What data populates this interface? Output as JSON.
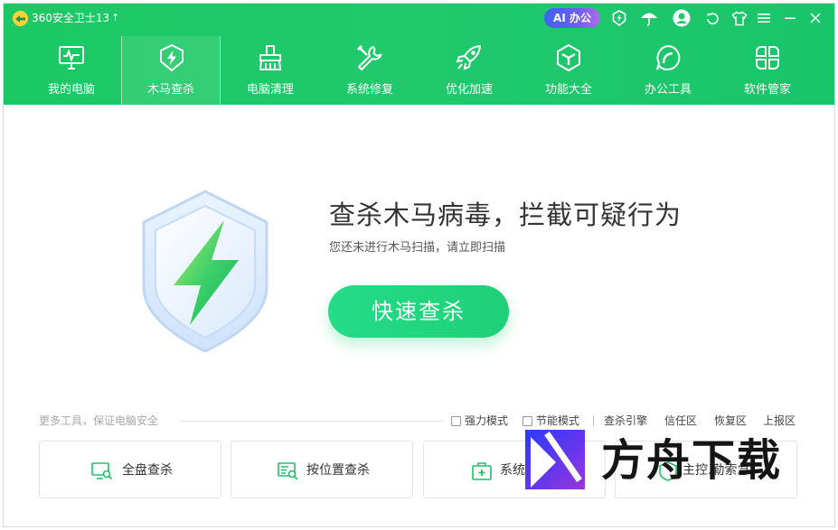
{
  "app": {
    "title": "360安全卫士13"
  },
  "titlebar": {
    "ai_button": "AI 办公"
  },
  "nav": [
    {
      "label": "我的电脑",
      "icon": "monitor-icon",
      "active": false
    },
    {
      "label": "木马查杀",
      "icon": "shield-icon",
      "active": true
    },
    {
      "label": "电脑清理",
      "icon": "broom-icon",
      "active": false
    },
    {
      "label": "系统修复",
      "icon": "wrench-icon",
      "active": false
    },
    {
      "label": "优化加速",
      "icon": "rocket-icon",
      "active": false
    },
    {
      "label": "功能大全",
      "icon": "cube-icon",
      "active": false
    },
    {
      "label": "办公工具",
      "icon": "office-icon",
      "active": false
    },
    {
      "label": "软件管家",
      "icon": "apps-icon",
      "active": false
    }
  ],
  "hero": {
    "title": "查杀木马病毒，拦截可疑行为",
    "subtitle": "您还未进行木马扫描，请立即扫描",
    "scan_button": "快速查杀"
  },
  "tools": {
    "caption": "更多工具，保证电脑安全",
    "options": [
      {
        "label": "强力模式",
        "checked": false
      },
      {
        "label": "节能模式",
        "checked": false
      }
    ],
    "links": [
      "查杀引擎",
      "信任区",
      "恢复区",
      "上报区"
    ],
    "cards": [
      "全盘查杀",
      "按位置查杀",
      "系统",
      "主控.勒索急"
    ]
  },
  "watermark": {
    "text": "方舟下载"
  },
  "colors": {
    "brand_green": "#1fc96a",
    "button_green": "#24dc87",
    "ai_gradient_start": "#3d62f2"
  }
}
